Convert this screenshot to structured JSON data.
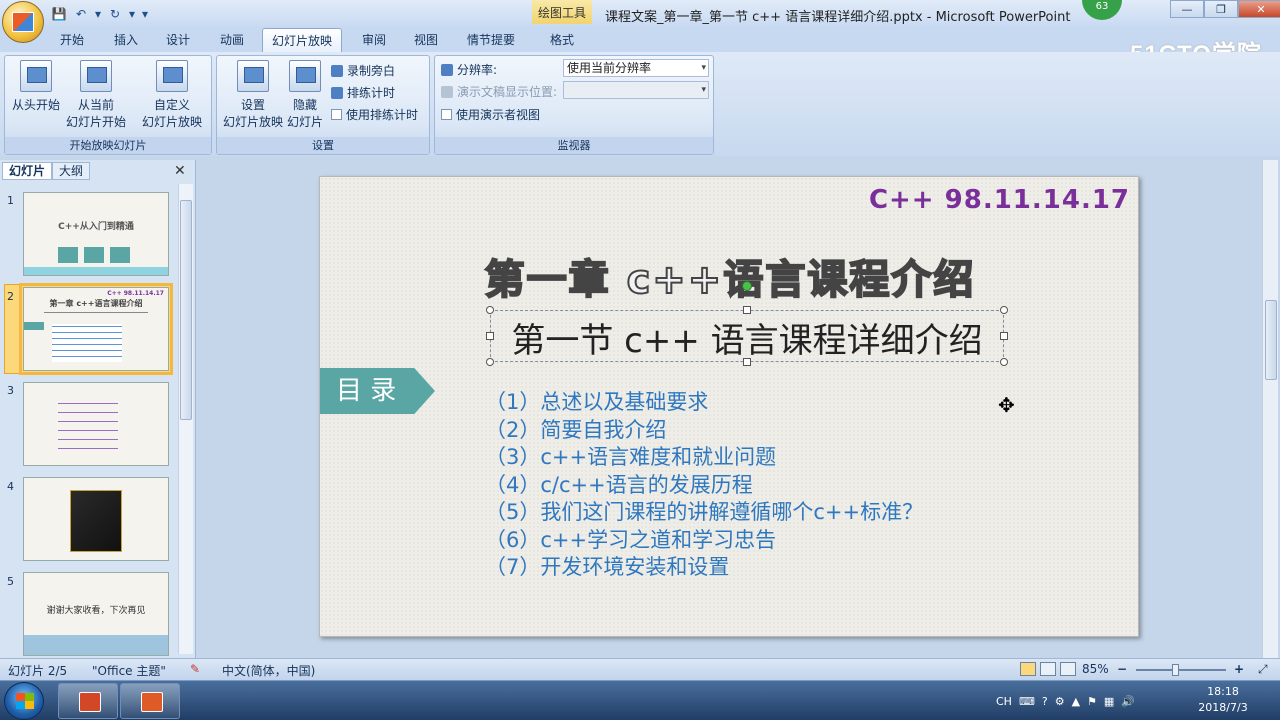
{
  "window": {
    "title": "课程文案_第一章_第一节 c++ 语言课程详细介绍.pptx - Microsoft PowerPoint",
    "context_tab": "绘图工具",
    "badge": "63",
    "minimize": "—",
    "restore": "❐",
    "close": "✕"
  },
  "qat": {
    "save": "💾",
    "undo": "↶",
    "undo_dd": "▾",
    "redo": "↻",
    "redo_dd": "▾",
    "customize": "▾"
  },
  "watermark": "51CTO学院",
  "tabs": [
    "开始",
    "插入",
    "设计",
    "动画",
    "幻灯片放映",
    "审阅",
    "视图",
    "情节提要",
    "格式"
  ],
  "ribbon": {
    "group1": {
      "label": "开始放映幻灯片",
      "btn1": "从头开始",
      "btn2a": "从当前",
      "btn2b": "幻灯片开始",
      "btn3a": "自定义",
      "btn3b": "幻灯片放映"
    },
    "group2": {
      "label": "设置",
      "btn1a": "设置",
      "btn1b": "幻灯片放映",
      "btn2a": "隐藏",
      "btn2b": "幻灯片",
      "record": "录制旁白",
      "rehearse": "排练计时",
      "use_timing": "使用排练计时"
    },
    "group3": {
      "label": "监视器",
      "resolution_label": "分辨率:",
      "resolution_value": "使用当前分辨率",
      "show_on_label": "演示文稿显示位置:",
      "show_on_value": "",
      "presenter_view": "使用演示者视图"
    }
  },
  "leftpane": {
    "tab_slides": "幻灯片",
    "tab_outline": "大纲",
    "close": "✕",
    "slides": [
      {
        "num": "1",
        "text": "C++从入门到精通"
      },
      {
        "num": "2",
        "text": "第一章 c++语言课程介绍"
      },
      {
        "num": "3",
        "text": ""
      },
      {
        "num": "4",
        "text": ""
      },
      {
        "num": "5",
        "text": "谢谢大家收看，下次再见"
      }
    ]
  },
  "slide": {
    "code": "C++ 98.11.14.17",
    "chapter": "第一章  c++语言课程介绍",
    "section": "第一节 c++ 语言课程详细介绍",
    "toc_label": "目 录",
    "toc": [
      "（1）总述以及基础要求",
      "（2）简要自我介绍",
      "（3）c++语言难度和就业问题",
      "（4）c/c++语言的发展历程",
      "（5）我们这门课程的讲解遵循哪个c++标准？",
      "（6）c++学习之道和学习忠告",
      "（7）开发环境安装和设置"
    ]
  },
  "status": {
    "slide_count": "幻灯片 2/5",
    "theme": "\"Office 主题\"",
    "language": "中文(简体，中国)",
    "zoom": "85%",
    "zoom_out": "−",
    "zoom_in": "+"
  },
  "taskbar": {
    "ime": "CH",
    "time": "18:18",
    "date": "2018/7/3"
  }
}
